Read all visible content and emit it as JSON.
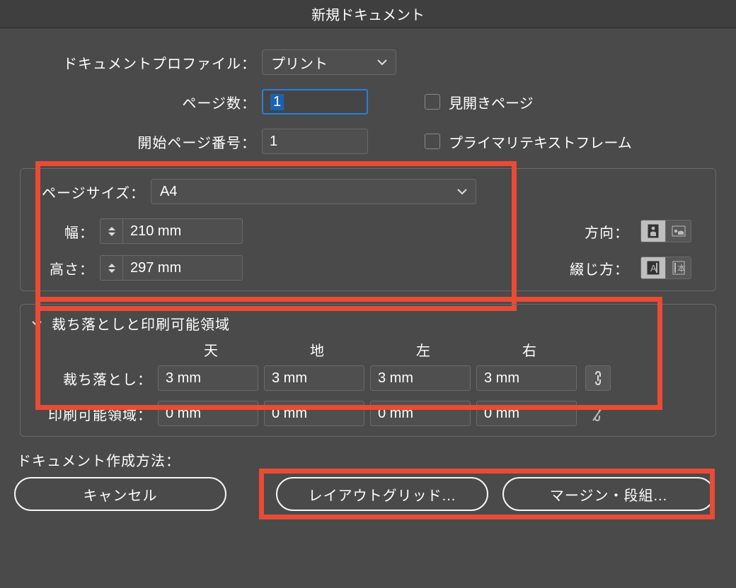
{
  "title": "新規ドキュメント",
  "profile": {
    "label": "ドキュメントプロファイル：",
    "value": "プリント"
  },
  "pages": {
    "count_label": "ページ数：",
    "count_value": "1",
    "start_label": "開始ページ番号：",
    "start_value": "1",
    "facing_label": "見開きページ",
    "primary_frame_label": "プライマリテキストフレーム"
  },
  "page_size": {
    "label": "ページサイズ：",
    "value": "A4",
    "width_label": "幅：",
    "width_value": "210 mm",
    "height_label": "高さ：",
    "height_value": "297 mm",
    "orientation_label": "方向：",
    "binding_label": "綴じ方："
  },
  "bleed_section": {
    "title": "裁ち落としと印刷可能領域",
    "columns": {
      "top": "天",
      "bottom": "地",
      "left": "左",
      "right": "右"
    },
    "bleed_label": "裁ち落とし：",
    "bleed": {
      "top": "3 mm",
      "bottom": "3 mm",
      "left": "3 mm",
      "right": "3 mm"
    },
    "slug_label": "印刷可能領域：",
    "slug": {
      "top": "0 mm",
      "bottom": "0 mm",
      "left": "0 mm",
      "right": "0 mm"
    }
  },
  "footer": {
    "method_label": "ドキュメント作成方法：",
    "cancel": "キャンセル",
    "layout_grid": "レイアウトグリッド...",
    "margin": "マージン・段組..."
  }
}
